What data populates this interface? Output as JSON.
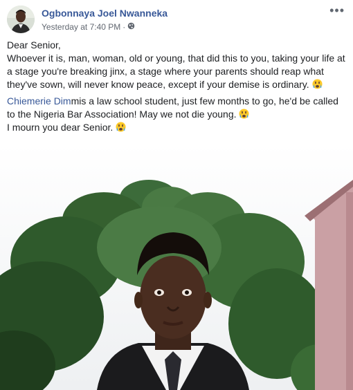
{
  "post": {
    "author": "Ogbonnaya Joel Nwanneka",
    "timestamp": "Yesterday at 7:40 PM",
    "separator": "·",
    "privacy_icon": "globe-icon",
    "more_icon": "more-options-icon",
    "more_glyph": "•••"
  },
  "text": {
    "greeting": "Dear Senior,",
    "paragraph1": "Whoever it is, man, woman, old or young, that did this to you, taking your life at a stage you're breaking jinx, a stage where your parents should reap what they've sown, will never know peace, except if your demise is ordinary.",
    "mention": "Chiemerie Dim",
    "paragraph2": "mis a law school student, just few months to go, he'd be called to the Nigeria Bar Association! May we not die young.",
    "paragraph3": "I mourn you dear Senior.",
    "emoji": "crying-face-emoji"
  },
  "colors": {
    "link": "#385898",
    "meta": "#616770",
    "text": "#1c1e21"
  }
}
